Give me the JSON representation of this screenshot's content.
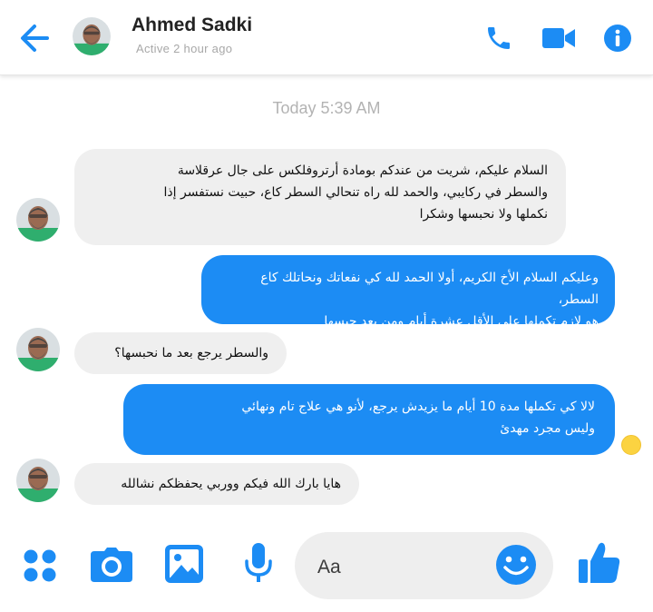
{
  "header": {
    "name": "Ahmed Sadki",
    "status": "Active 2 hour ago"
  },
  "chat": {
    "timestamp": "Today 5:39 AM",
    "messages": [
      {
        "direction": "incoming",
        "lines": [
          "السلام عليكم، شريت من عندكم بومادة أرتروفلكس على جال عرقلاسة",
          "والسطر في ركايبي، والحمد لله راه تنحالي السطر كاع، حبيت نستفسر إذا",
          "نكملها ولا نحبسها وشكرا"
        ]
      },
      {
        "direction": "outgoing",
        "lines": [
          "وعليكم السلام الأخ الكريم، أولا الحمد لله كي نفعاتك ونحاتلك كاع السطر،",
          "هو لازم تكملها على الأقل عشرة أيام ومن بعد حبسها"
        ]
      },
      {
        "direction": "incoming",
        "lines": [
          "والسطر يرجع بعد ما نحبسها؟"
        ]
      },
      {
        "direction": "outgoing",
        "lines": [
          "لالا كي تكملها مدة 10 أيام ما يزيدش يرجع، لأنو هي علاج تام ونهائي",
          "وليس مجرد مهدئ"
        ]
      },
      {
        "direction": "incoming",
        "lines": [
          "هايا بارك الله فيكم ووربي يحفظكم نشالله"
        ]
      }
    ]
  },
  "composer": {
    "placeholder": "Aa"
  },
  "colors": {
    "accent": "#1c8cf4",
    "incoming_bubble": "#efefef",
    "seen_indicator": "#fbd341"
  },
  "icons": {
    "back": "back-arrow-icon",
    "call": "phone-icon",
    "video": "video-camera-icon",
    "info": "info-icon",
    "menu": "grid-dots-icon",
    "camera": "camera-icon",
    "gallery": "image-icon",
    "voice": "microphone-icon",
    "emoji": "smiley-icon",
    "like": "thumbs-up-icon"
  }
}
